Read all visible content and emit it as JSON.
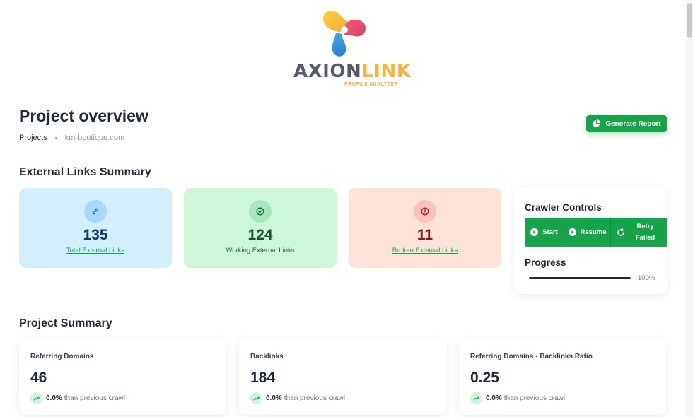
{
  "logo": {
    "word_part1": "AXION",
    "word_part2": "LINK",
    "tagline": "PROFILE ANALYZER"
  },
  "header": {
    "title": "Project overview",
    "breadcrumb": [
      "Projects",
      "km-boutique.com"
    ],
    "generate_button": "Generate Report"
  },
  "external_links": {
    "title": "External Links Summary",
    "cards": [
      {
        "value": "135",
        "label": "Total External Links",
        "icon": "link-icon"
      },
      {
        "value": "124",
        "label": "Working External Links",
        "icon": "check-circle-icon"
      },
      {
        "value": "11",
        "label": "Broken External Links",
        "icon": "alert-circle-icon"
      }
    ]
  },
  "crawler": {
    "title": "Crawler Controls",
    "buttons": {
      "start": "Start",
      "resume": "Resume",
      "retry": "Retry Failed"
    },
    "progress_title": "Progress",
    "progress_value": 100,
    "progress_text": "100%"
  },
  "project_summary": {
    "title": "Project Summary",
    "cards": [
      {
        "label": "Referring Domains",
        "value": "46",
        "change": "0.0%",
        "change_text": "than previous crawl"
      },
      {
        "label": "Backlinks",
        "value": "184",
        "change": "0.0%",
        "change_text": "than previous crawl"
      },
      {
        "label": "Referring Domains - Backlinks Ratio",
        "value": "0.25",
        "change": "0.0%",
        "change_text": "than previous crawl"
      }
    ]
  },
  "colors": {
    "primary": "#16a34a",
    "blue_card": "#d3effd",
    "green_card": "#cdf7d8",
    "red_card": "#fde3d7",
    "logo_gray": "#555b66",
    "logo_orange": "#f6b43c"
  }
}
